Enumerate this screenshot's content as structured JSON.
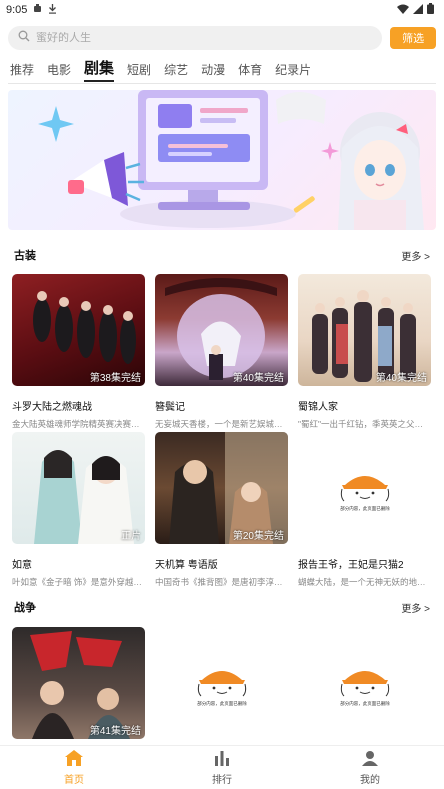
{
  "status_bar": {
    "time": "9:05"
  },
  "search": {
    "placeholder": "蜜好的人生",
    "filter_label": "筛选"
  },
  "tabs": [
    {
      "label": "推荐"
    },
    {
      "label": "电影"
    },
    {
      "label": "剧集",
      "active": true
    },
    {
      "label": "短剧"
    },
    {
      "label": "综艺"
    },
    {
      "label": "动漫"
    },
    {
      "label": "体育"
    },
    {
      "label": "纪录片"
    }
  ],
  "sections": [
    {
      "title": "古装",
      "more": "更多 >",
      "items": [
        {
          "title": "斗罗大陆之燃魂战",
          "desc": "金大陆英雄魂师学院精英赛决赛…",
          "badge": "第38集完结"
        },
        {
          "title": "簪鬓记",
          "desc": "无妄城天香楼，一个是新艺娱城…",
          "badge": "第40集完结"
        },
        {
          "title": "蜀锦人家",
          "desc": "\"蜀红\"一出千红钻，季英英之父…",
          "badge": "第40集完结"
        },
        {
          "title": "如意",
          "desc": "叶如意《金子暗 饰》是意外穿越…",
          "badge": "正片"
        },
        {
          "title": "天机算 粤语版",
          "desc": "中国奇书《推背图》是唐初李淳…",
          "badge": "第20集完结"
        },
        {
          "title": "报告王爷，王妃是只猫2",
          "desc": "蝴蝶大陆，是一个无神无妖的地…",
          "badge": ""
        }
      ]
    },
    {
      "title": "战争",
      "more": "更多 >",
      "items": [
        {
          "title": "",
          "desc": "",
          "badge": "第41集完结"
        },
        {
          "title": "",
          "desc": "",
          "badge": ""
        },
        {
          "title": "",
          "desc": "",
          "badge": ""
        }
      ]
    }
  ],
  "placeholder_caption": "部分内容，此页面已删除",
  "bottom_nav": [
    {
      "label": "首页",
      "active": true
    },
    {
      "label": "排行"
    },
    {
      "label": "我的"
    }
  ],
  "colors": {
    "accent": "#f7a125"
  }
}
